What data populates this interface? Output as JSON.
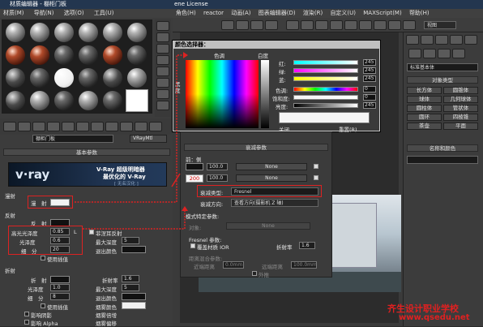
{
  "material_editor": {
    "title": "材质编辑器 - 棚柜门板",
    "menu": [
      "材质(M)",
      "导航(N)",
      "选项(O)",
      "工具(U)"
    ],
    "material_name": "棚柜门板",
    "material_type": "VRayMtl",
    "basic_params_rollout": "基本参数",
    "banner": {
      "logo": "v·ray",
      "line1": "V-Ray 超级明暗器",
      "line2": "最优化的 V-Ray",
      "line3": "[ 无名汉化 ]"
    },
    "diffuse": {
      "group": "漫射",
      "label": "漫　射"
    },
    "reflection": {
      "group": "反射",
      "label": "反　射",
      "hilight_gloss_label": "高光光泽度",
      "hilight_gloss_value": "0.85",
      "hilight_lock": "L",
      "refl_gloss_label": "光泽度",
      "refl_gloss_value": "0.6",
      "subdivs_label": "细　分",
      "subdivs_value": "20",
      "fresnel_label": "菲涅耳反射",
      "max_depth_label": "最大深度",
      "max_depth_value": "5",
      "exit_color_label": "退出颜色",
      "use_interp_label": "使用插值"
    },
    "refraction": {
      "group": "折射",
      "label": "折　射",
      "ior_label": "折射率",
      "ior_value": "1.6",
      "gloss_label": "光泽度",
      "gloss_value": "1.0",
      "max_depth_label": "最大深度",
      "max_depth_value": "5",
      "subdivs_label": "细　分",
      "subdivs_value": "8",
      "exit_color_label": "退出颜色",
      "use_interp_label": "使用插值",
      "fog_color_label": "烟雾颜色",
      "shadows_label": "影响阴影",
      "fog_mult_label": "烟雾倍增",
      "alpha_label": "影响 Alpha",
      "fog_bias_label": "烟雾偏移"
    }
  },
  "max_window": {
    "title": "ene License",
    "menu": [
      "角色(H)",
      "reactor",
      "动画(A)",
      "图表编辑器(D)",
      "渲染(R)",
      "自定义(U)",
      "MAXScript(M)",
      "帮助(H)"
    ],
    "viewport_label": "视图"
  },
  "command_panel": {
    "category": "标准基本体",
    "object_type_rollout": "对象类型",
    "buttons": [
      "长方体",
      "圆锥体",
      "球体",
      "几何球体",
      "圆柱体",
      "管状体",
      "圆环",
      "四棱锥",
      "茶壶",
      "平面"
    ],
    "name_color_rollout": "名称和颜色"
  },
  "color_selector": {
    "title": "颜色选择器：",
    "hue_label": "色调",
    "whiteness_label": "白度",
    "blackness_label": "黑度",
    "channels": [
      {
        "label": "红:",
        "value": "245"
      },
      {
        "label": "绿:",
        "value": "245"
      },
      {
        "label": "蓝:",
        "value": "245"
      },
      {
        "label": "色调:",
        "value": "0"
      },
      {
        "label": "饱和度:",
        "value": "0"
      },
      {
        "label": "亮度:",
        "value": "245"
      }
    ],
    "close_button": "关闭",
    "reset_button": "重置(R)"
  },
  "falloff": {
    "rollout": "衰减参数",
    "front_side_label": "前：侧",
    "front_amount": "100.0",
    "side_amount": "100.0",
    "map1": "None",
    "map2": "None",
    "side_value": "200",
    "falloff_type_label": "衰减类型:",
    "falloff_type_value": "Fresnel",
    "falloff_dir_label": "衰减方向:",
    "falloff_dir_value": "查看方向(摄影机 Z 轴)",
    "mode_rollout": "模式特定参数:",
    "object_label": "对象:",
    "object_value": "None",
    "fresnel_params_label": "Fresnel 参数:",
    "override_ior_label": "覆盖材质 IOR",
    "ior_label": "折射率",
    "ior_value": "1.6",
    "dist_blend_label": "距离混合参数:",
    "near_label": "近端距离",
    "near_value": "0.0mm",
    "far_label": "远端距离",
    "far_value": "100.0mm",
    "extrapolate_label": "外推"
  },
  "watermark": {
    "line1": "齐生设计职业学校",
    "line2": "www.qsedu.net"
  },
  "colors": {
    "title_bar": "#23364f",
    "highlight_red": "#dd2222",
    "watermark": "#e02020"
  }
}
